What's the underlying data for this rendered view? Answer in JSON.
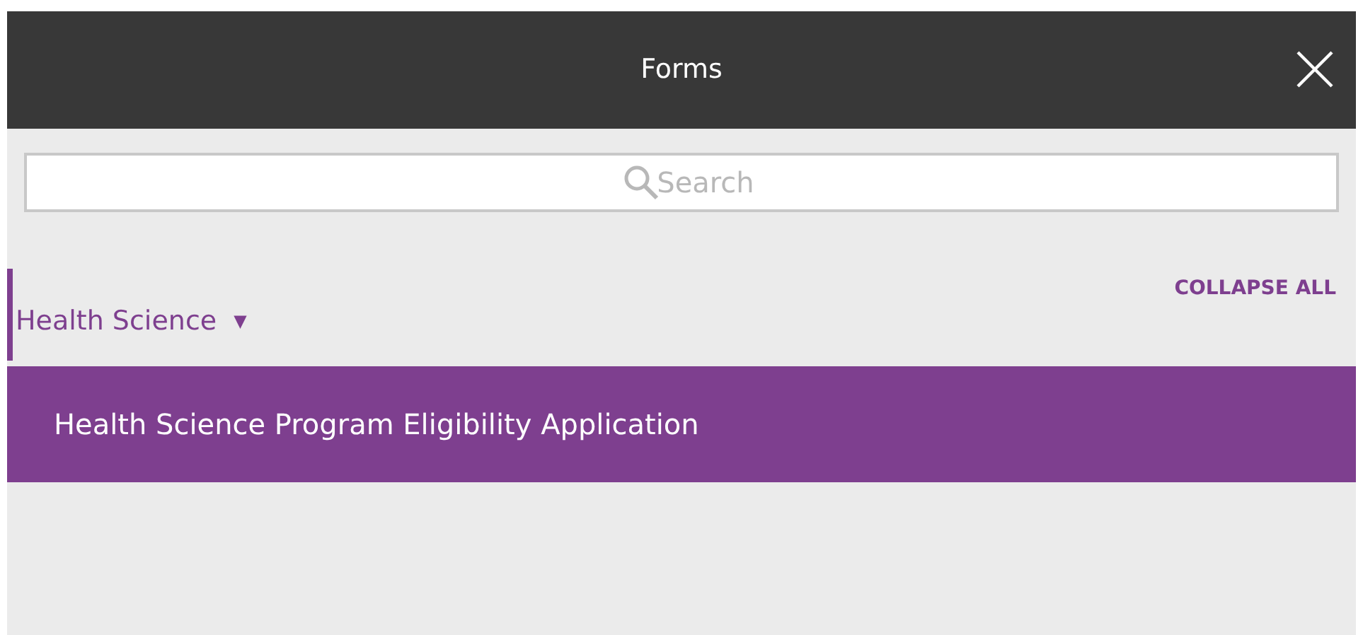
{
  "window": {
    "title": "Forms"
  },
  "search": {
    "placeholder": "Search"
  },
  "collapse_all": "COLLAPSE ALL",
  "groups": [
    {
      "label": "Health Science",
      "toggle": "▼",
      "expanded": true,
      "forms": [
        {
          "label": "Health Science Program Eligibility Application",
          "selected": true
        }
      ]
    }
  ]
}
